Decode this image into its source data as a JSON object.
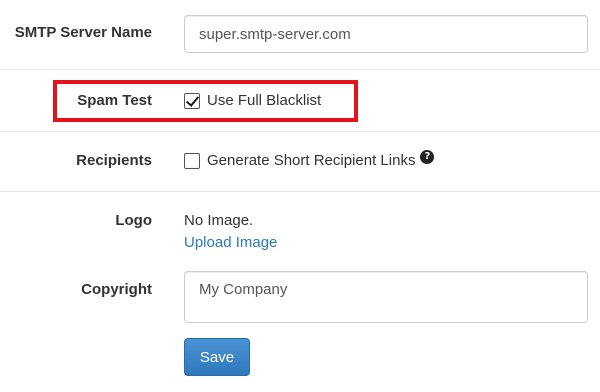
{
  "smtp": {
    "label": "SMTP Server Name",
    "value": "super.smtp-server.com"
  },
  "spam_test": {
    "label": "Spam Test",
    "checkbox_label": "Use Full Blacklist",
    "checked": true,
    "highlight_color": "#e3121c"
  },
  "recipients": {
    "label": "Recipients",
    "checkbox_label": "Generate Short Recipient Links",
    "checked": false,
    "help_glyph": "?"
  },
  "logo": {
    "label": "Logo",
    "status": "No Image.",
    "upload_link": "Upload Image"
  },
  "copyright": {
    "label": "Copyright",
    "value": "My Company"
  },
  "actions": {
    "save_label": "Save"
  },
  "colors": {
    "link": "#2a7ab5",
    "primary_button": "#337ab7"
  }
}
